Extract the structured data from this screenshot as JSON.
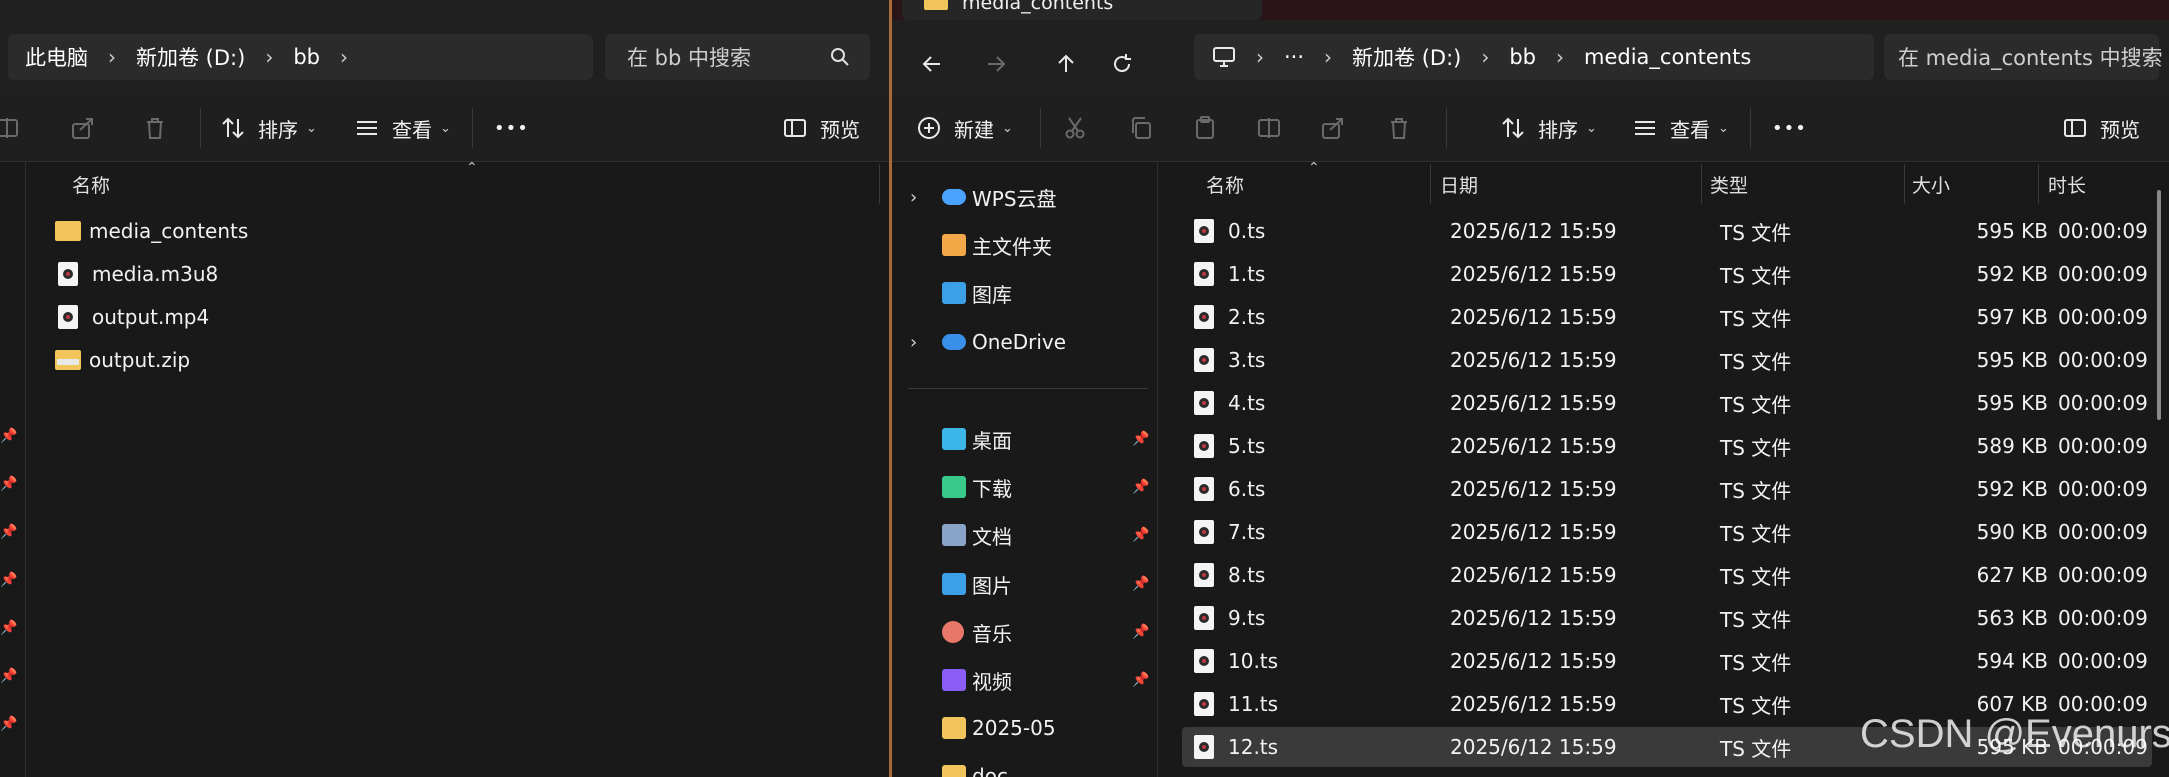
{
  "left": {
    "breadcrumb": [
      "此电脑",
      "新加卷 (D:)",
      "bb"
    ],
    "search_placeholder": "在 bb 中搜索",
    "cmd": {
      "sort": "排序",
      "view": "查看",
      "more": "•••",
      "preview": "预览"
    },
    "header": {
      "name": "名称"
    },
    "files": [
      {
        "name": "media_contents",
        "icon": "folder"
      },
      {
        "name": "media.m3u8",
        "icon": "file-media"
      },
      {
        "name": "output.mp4",
        "icon": "file-media"
      },
      {
        "name": "output.zip",
        "icon": "zip"
      }
    ]
  },
  "right": {
    "tab_title": "media_contents",
    "breadcrumb": [
      "新加卷 (D:)",
      "bb",
      "media_contents"
    ],
    "breadcrumb_overflow": "···",
    "search_placeholder": "在 media_contents 中搜索",
    "cmd": {
      "new": "新建",
      "sort": "排序",
      "view": "查看",
      "more": "•••",
      "preview": "预览"
    },
    "nav": [
      {
        "label": "WPS云盘",
        "icon": "cloud-icon",
        "expandable": true,
        "pinned": false,
        "color": "#4aa3ff"
      },
      {
        "label": "主文件夹",
        "icon": "home-icon",
        "expandable": false,
        "pinned": false,
        "color": "#f3a847"
      },
      {
        "label": "图库",
        "icon": "gallery-icon",
        "expandable": false,
        "pinned": false,
        "color": "#3ba0e6"
      },
      {
        "label": "OneDrive",
        "icon": "onedrive-icon",
        "expandable": true,
        "pinned": false,
        "color": "#3a8fe8"
      },
      {
        "label": "桌面",
        "icon": "desktop-icon",
        "expandable": false,
        "pinned": true,
        "color": "#3cb6e8"
      },
      {
        "label": "下载",
        "icon": "download-icon",
        "expandable": false,
        "pinned": true,
        "color": "#38c98a"
      },
      {
        "label": "文档",
        "icon": "document-icon",
        "expandable": false,
        "pinned": true,
        "color": "#8aa4c8"
      },
      {
        "label": "图片",
        "icon": "pictures-icon",
        "expandable": false,
        "pinned": true,
        "color": "#3ba0e6"
      },
      {
        "label": "音乐",
        "icon": "music-icon",
        "expandable": false,
        "pinned": true,
        "color": "#e8776a"
      },
      {
        "label": "视频",
        "icon": "video-icon",
        "expandable": false,
        "pinned": true,
        "color": "#8b5cf6"
      },
      {
        "label": "2025-05",
        "icon": "folder-icon",
        "expandable": false,
        "pinned": false,
        "color": "#f2c55c"
      },
      {
        "label": "doc",
        "icon": "folder-icon",
        "expandable": false,
        "pinned": false,
        "color": "#f2c55c"
      }
    ],
    "headers": {
      "name": "名称",
      "date": "日期",
      "type": "类型",
      "size": "大小",
      "duration": "时长"
    },
    "files": [
      {
        "name": "0.ts",
        "date": "2025/6/12 15:59",
        "type": "TS 文件",
        "size": "595 KB",
        "duration": "00:00:09"
      },
      {
        "name": "1.ts",
        "date": "2025/6/12 15:59",
        "type": "TS 文件",
        "size": "592 KB",
        "duration": "00:00:09"
      },
      {
        "name": "2.ts",
        "date": "2025/6/12 15:59",
        "type": "TS 文件",
        "size": "597 KB",
        "duration": "00:00:09"
      },
      {
        "name": "3.ts",
        "date": "2025/6/12 15:59",
        "type": "TS 文件",
        "size": "595 KB",
        "duration": "00:00:09"
      },
      {
        "name": "4.ts",
        "date": "2025/6/12 15:59",
        "type": "TS 文件",
        "size": "595 KB",
        "duration": "00:00:09"
      },
      {
        "name": "5.ts",
        "date": "2025/6/12 15:59",
        "type": "TS 文件",
        "size": "589 KB",
        "duration": "00:00:09"
      },
      {
        "name": "6.ts",
        "date": "2025/6/12 15:59",
        "type": "TS 文件",
        "size": "592 KB",
        "duration": "00:00:09"
      },
      {
        "name": "7.ts",
        "date": "2025/6/12 15:59",
        "type": "TS 文件",
        "size": "590 KB",
        "duration": "00:00:09"
      },
      {
        "name": "8.ts",
        "date": "2025/6/12 15:59",
        "type": "TS 文件",
        "size": "627 KB",
        "duration": "00:00:09"
      },
      {
        "name": "9.ts",
        "date": "2025/6/12 15:59",
        "type": "TS 文件",
        "size": "563 KB",
        "duration": "00:00:09"
      },
      {
        "name": "10.ts",
        "date": "2025/6/12 15:59",
        "type": "TS 文件",
        "size": "594 KB",
        "duration": "00:00:09"
      },
      {
        "name": "11.ts",
        "date": "2025/6/12 15:59",
        "type": "TS 文件",
        "size": "607 KB",
        "duration": "00:00:09"
      },
      {
        "name": "12.ts",
        "date": "2025/6/12 15:59",
        "type": "TS 文件",
        "size": "595 KB",
        "duration": "00:00:09",
        "selected": true
      }
    ]
  },
  "watermark": "CSDN @Evenurs"
}
